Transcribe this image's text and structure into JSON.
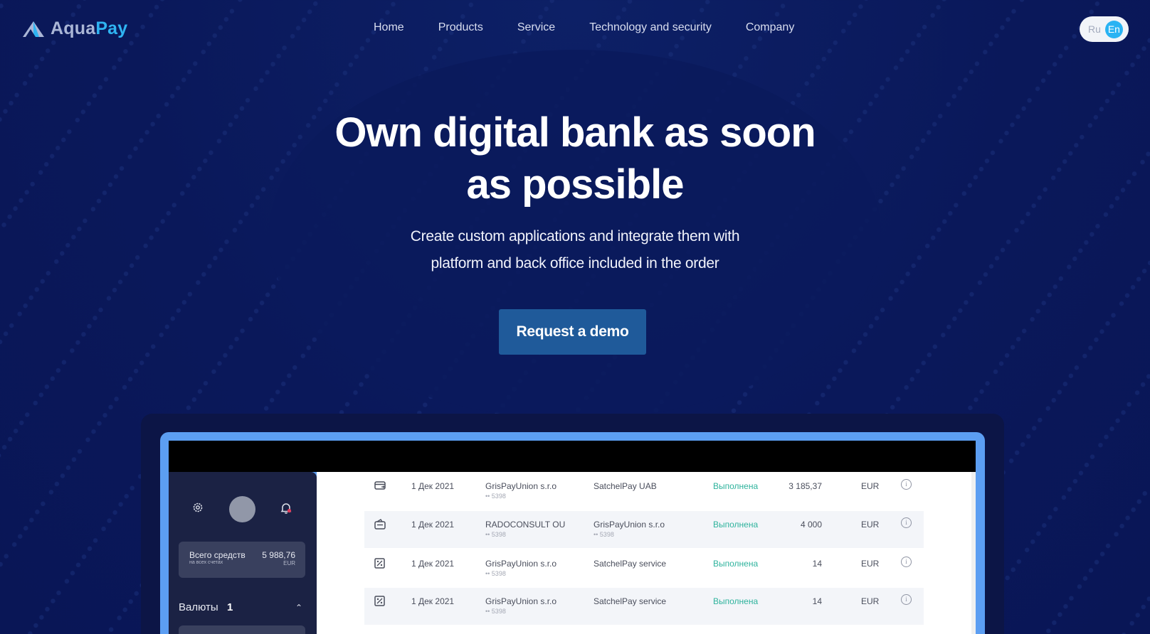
{
  "brand": {
    "name_part1": "Aqua",
    "name_part2": "Pay",
    "accent_color": "#2fb4f2"
  },
  "nav": {
    "items": [
      {
        "label": "Home"
      },
      {
        "label": "Products"
      },
      {
        "label": "Service"
      },
      {
        "label": "Technology and security"
      },
      {
        "label": "Company"
      }
    ]
  },
  "language": {
    "options": [
      "Ru",
      "En"
    ],
    "selected": "En"
  },
  "hero": {
    "title_line1": "Own digital bank as soon",
    "title_line2": "as possible",
    "subtitle_line1": "Create custom applications and integrate them with",
    "subtitle_line2": "platform and back office included in the order",
    "cta_label": "Request a demo",
    "cta_color": "#1f5a9a"
  },
  "app_preview": {
    "sidebar": {
      "icons": [
        "gear-icon",
        "avatar",
        "bell-icon"
      ],
      "total_label": "Всего средств",
      "total_sub": "на всех счетах",
      "total_value": "5 988,76",
      "total_currency": "EUR",
      "currencies_label": "Валюты",
      "currencies_count": "1"
    },
    "transactions": [
      {
        "icon": "transfer-icon",
        "date": "1 Дек 2021",
        "sender": "GrisPayUnion s.r.o",
        "sender_acc": "•• 5398",
        "receiver": "SatchelPay UAB",
        "receiver_acc": "",
        "status": "Выполнена",
        "amount": "3 185,37",
        "currency": "EUR"
      },
      {
        "icon": "wallet-icon",
        "date": "1 Дек 2021",
        "sender": "RADOCONSULT OU",
        "sender_acc": "•• 5398",
        "receiver": "GrisPayUnion s.r.o",
        "receiver_acc": "•• 5398",
        "status": "Выполнена",
        "amount": "4 000",
        "currency": "EUR"
      },
      {
        "icon": "percent-icon",
        "date": "1 Дек 2021",
        "sender": "GrisPayUnion s.r.o",
        "sender_acc": "•• 5398",
        "receiver": "SatchelPay service",
        "receiver_acc": "",
        "status": "Выполнена",
        "amount": "14",
        "currency": "EUR"
      },
      {
        "icon": "percent-icon",
        "date": "1 Дек 2021",
        "sender": "GrisPayUnion s.r.o",
        "sender_acc": "•• 5398",
        "receiver": "SatchelPay service",
        "receiver_acc": "",
        "status": "Выполнена",
        "amount": "14",
        "currency": "EUR"
      }
    ],
    "status_color": "#2fb39d"
  }
}
